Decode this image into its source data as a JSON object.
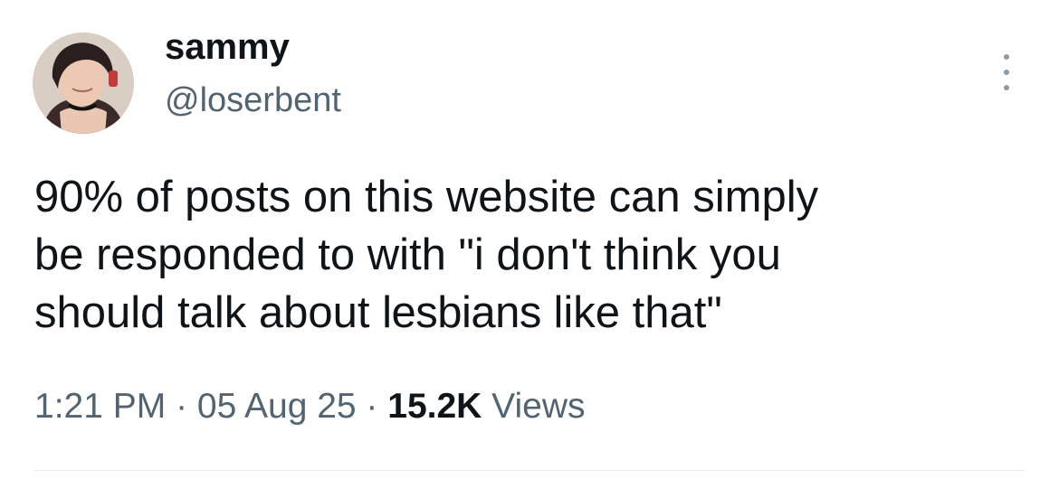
{
  "tweet": {
    "author": {
      "display_name": "sammy",
      "handle": "@loserbent"
    },
    "text_lines": [
      "90% of posts on this website can simply",
      "be responded to with \"i don't think you",
      "should talk about",
      "lesbians",
      "like that\""
    ],
    "meta": {
      "time": "1:21 PM",
      "sep1": " · ",
      "date": "05 Aug 25",
      "sep2": " · ",
      "views_count": "15.2K",
      "views_label": " Views"
    }
  },
  "icons": {
    "more": "more-vertical-icon"
  },
  "colors": {
    "text": "#0f1419",
    "secondary": "#536471",
    "divider": "#e6ecf0"
  }
}
